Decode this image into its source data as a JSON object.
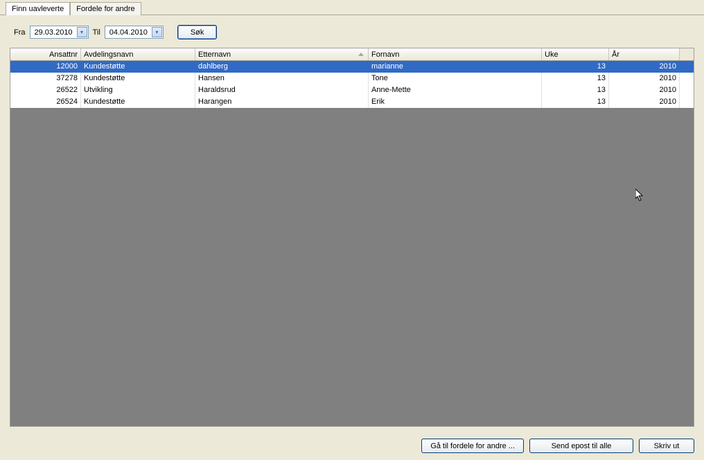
{
  "tabs": {
    "tab1": "Finn uavleverte",
    "tab2": "Fordele for andre"
  },
  "filter": {
    "fra_label": "Fra",
    "fra_value": "29.03.2010",
    "til_label": "Til",
    "til_value": "04.04.2010",
    "search_label": "Søk"
  },
  "columns": {
    "ansattnr": "Ansattnr",
    "avdelingsnavn": "Avdelingsnavn",
    "etternavn": "Etternavn",
    "fornavn": "Fornavn",
    "uke": "Uke",
    "ar": "År"
  },
  "rows": [
    {
      "ansattnr": "12000",
      "avd": "Kundestøtte",
      "ett": "dahlberg",
      "for": "marianne",
      "uke": "13",
      "ar": "2010",
      "selected": true
    },
    {
      "ansattnr": "37278",
      "avd": "Kundestøtte",
      "ett": "Hansen",
      "for": "Tone",
      "uke": "13",
      "ar": "2010",
      "selected": false
    },
    {
      "ansattnr": "26522",
      "avd": "Utvikling",
      "ett": "Haraldsrud",
      "for": "Anne-Mette",
      "uke": "13",
      "ar": "2010",
      "selected": false
    },
    {
      "ansattnr": "26524",
      "avd": "Kundestøtte",
      "ett": "Harangen",
      "for": "Erik",
      "uke": "13",
      "ar": "2010",
      "selected": false
    }
  ],
  "footer": {
    "goto": "Gå til fordele for andre ...",
    "send": "Send epost til alle",
    "print": "Skriv ut"
  }
}
